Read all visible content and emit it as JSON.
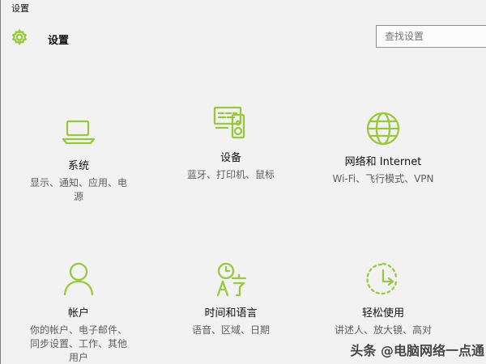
{
  "window": {
    "title": "设置"
  },
  "header": {
    "title": "设置",
    "gear_icon": "gear-icon",
    "search_placeholder": "查找设置"
  },
  "tiles": [
    {
      "label": "系统",
      "description": "显示、通知、应用、电\n源",
      "icon": "laptop-icon"
    },
    {
      "label": "设备",
      "description": "蓝牙、打印机、鼠标",
      "icon": "devices-icon"
    },
    {
      "label": "网络和 Internet",
      "description": "Wi-Fi、飞行模式、VPN",
      "icon": "globe-icon"
    },
    {
      "label": "帐户",
      "description": "你的帐户、电子邮件、\n同步设置、工作、其他\n用户",
      "icon": "user-icon"
    },
    {
      "label": "时间和语言",
      "description": "语音、区域、日期",
      "icon": "time-language-icon"
    },
    {
      "label": "轻松使用",
      "description": "讲述人、放大镜、高对",
      "icon": "ease-of-access-icon"
    }
  ],
  "watermark": "头条 @电脑网络一点通",
  "colors": {
    "accent": "#98c83c",
    "background": "#f2f2f2"
  }
}
